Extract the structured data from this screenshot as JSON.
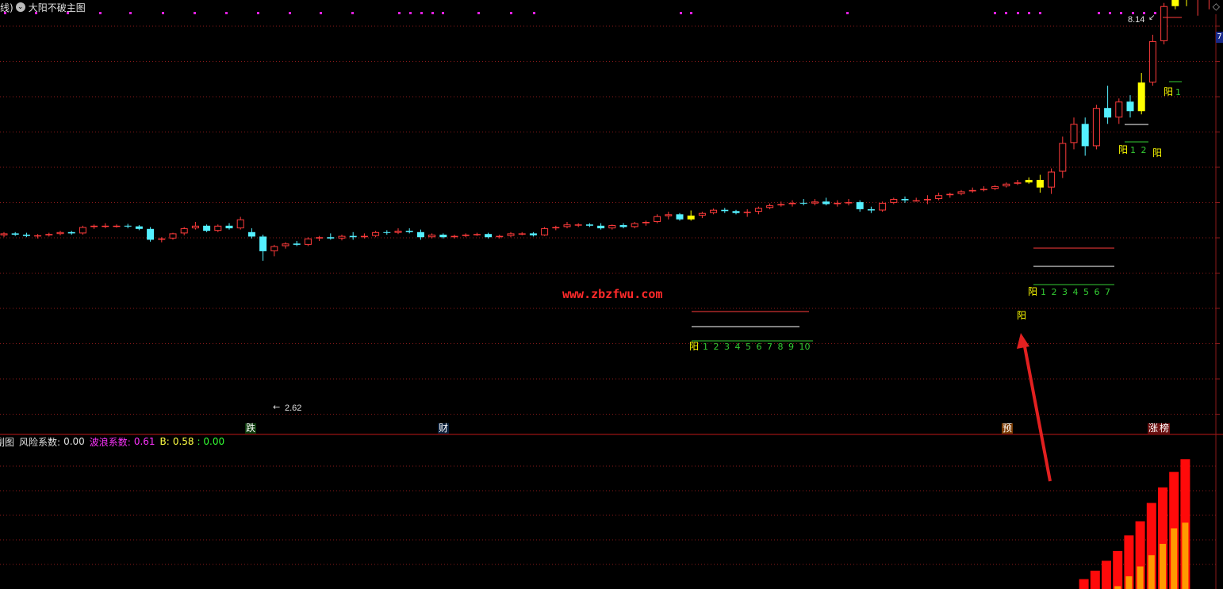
{
  "main": {
    "title_prefix": "线)",
    "title": "大阳不破主图",
    "price_tag": "7",
    "high_label": "8.14",
    "low_label": "2.62",
    "watermark": "www.zbzfwu.com",
    "signals": [
      {
        "text": "阳",
        "nums": "1 2 3 4 5 6 7 8 9 10"
      },
      {
        "text": "阳",
        "nums": "1 2 3 4 5 6 7"
      },
      {
        "text": "阳",
        "nums": "1 2"
      },
      {
        "text": "阳",
        "nums": "1"
      }
    ],
    "bottom_tags": [
      "跌",
      "财",
      "预",
      "涨",
      "榜"
    ]
  },
  "sub": {
    "name": "副图",
    "risk_label": "风险系数:",
    "risk_value": "0.00",
    "wave_label": "波浪系数:",
    "wave_value": "0.61",
    "b_label": "B:",
    "b_value": "0.58",
    "extra_value": ": 0.00"
  },
  "colors": {
    "up": "#ff3b3b",
    "down": "#54f0ff",
    "signal": "#ffff00",
    "count": "#33cc33",
    "grid": "#8b1a1a",
    "bar_red": "#ff0a0a",
    "bar_orange": "#ff9900"
  },
  "chart_data": {
    "type": "candlestick",
    "series": [
      {
        "name": "price",
        "candles": [
          [
            2.95,
            3.0,
            2.92,
            2.98
          ],
          [
            2.98,
            3.0,
            2.94,
            2.96
          ],
          [
            2.96,
            2.99,
            2.92,
            2.94
          ],
          [
            2.94,
            2.97,
            2.9,
            2.95
          ],
          [
            2.95,
            2.99,
            2.93,
            2.97
          ],
          [
            2.97,
            3.02,
            2.95,
            3.0
          ],
          [
            3.0,
            3.02,
            2.96,
            2.98
          ],
          [
            2.98,
            3.1,
            2.96,
            3.08
          ],
          [
            3.08,
            3.12,
            3.05,
            3.1
          ],
          [
            3.1,
            3.14,
            3.06,
            3.1
          ],
          [
            3.1,
            3.12,
            3.07,
            3.1
          ],
          [
            3.1,
            3.13,
            3.06,
            3.09
          ],
          [
            3.09,
            3.11,
            3.03,
            3.05
          ],
          [
            3.05,
            3.08,
            2.85,
            2.88
          ],
          [
            2.88,
            2.92,
            2.84,
            2.9
          ],
          [
            2.9,
            2.99,
            2.88,
            2.98
          ],
          [
            2.98,
            3.08,
            2.95,
            3.06
          ],
          [
            3.06,
            3.16,
            3.04,
            3.1
          ],
          [
            3.1,
            3.12,
            3.0,
            3.02
          ],
          [
            3.02,
            3.12,
            3.0,
            3.1
          ],
          [
            3.1,
            3.14,
            3.04,
            3.06
          ],
          [
            3.06,
            3.24,
            3.04,
            3.2
          ],
          [
            3.0,
            3.06,
            2.9,
            2.93
          ],
          [
            2.93,
            2.96,
            2.55,
            2.7
          ],
          [
            2.7,
            2.8,
            2.62,
            2.78
          ],
          [
            2.78,
            2.84,
            2.74,
            2.82
          ],
          [
            2.82,
            2.86,
            2.78,
            2.8
          ],
          [
            2.8,
            2.92,
            2.78,
            2.9
          ],
          [
            2.9,
            2.94,
            2.86,
            2.92
          ],
          [
            2.92,
            2.98,
            2.88,
            2.9
          ],
          [
            2.9,
            2.96,
            2.87,
            2.94
          ],
          [
            2.94,
            3.0,
            2.88,
            2.92
          ],
          [
            2.92,
            2.98,
            2.9,
            2.94
          ],
          [
            2.94,
            3.02,
            2.92,
            3.0
          ],
          [
            3.0,
            3.03,
            2.96,
            2.99
          ],
          [
            2.99,
            3.06,
            2.97,
            3.02
          ],
          [
            3.02,
            3.06,
            2.98,
            3.0
          ],
          [
            3.0,
            3.04,
            2.88,
            2.92
          ],
          [
            2.92,
            2.98,
            2.9,
            2.96
          ],
          [
            2.96,
            2.98,
            2.9,
            2.92
          ],
          [
            2.92,
            2.96,
            2.9,
            2.94
          ],
          [
            2.94,
            2.98,
            2.92,
            2.96
          ],
          [
            2.96,
            2.99,
            2.94,
            2.97
          ],
          [
            2.97,
            2.99,
            2.9,
            2.92
          ],
          [
            2.92,
            2.96,
            2.9,
            2.94
          ],
          [
            2.94,
            3.0,
            2.92,
            2.98
          ],
          [
            2.98,
            3.0,
            2.95,
            2.98
          ],
          [
            2.98,
            3.0,
            2.93,
            2.95
          ],
          [
            2.95,
            3.08,
            2.94,
            3.06
          ],
          [
            3.06,
            3.1,
            3.03,
            3.08
          ],
          [
            3.08,
            3.16,
            3.06,
            3.12
          ],
          [
            3.12,
            3.14,
            3.08,
            3.12
          ],
          [
            3.12,
            3.14,
            3.08,
            3.1
          ],
          [
            3.1,
            3.14,
            3.04,
            3.06
          ],
          [
            3.06,
            3.12,
            3.04,
            3.11
          ],
          [
            3.11,
            3.14,
            3.06,
            3.08
          ],
          [
            3.08,
            3.16,
            3.06,
            3.14
          ],
          [
            3.14,
            3.18,
            3.1,
            3.16
          ],
          [
            3.16,
            3.28,
            3.14,
            3.25
          ],
          [
            3.25,
            3.32,
            3.2,
            3.28
          ],
          [
            3.28,
            3.3,
            3.18,
            3.2
          ],
          [
            3.2,
            3.34,
            3.18,
            3.26
          ],
          [
            3.26,
            3.32,
            3.22,
            3.3
          ],
          [
            3.3,
            3.37,
            3.28,
            3.35
          ],
          [
            3.35,
            3.38,
            3.3,
            3.33
          ],
          [
            3.33,
            3.35,
            3.28,
            3.3
          ],
          [
            3.3,
            3.36,
            3.24,
            3.32
          ],
          [
            3.32,
            3.4,
            3.28,
            3.38
          ],
          [
            3.38,
            3.45,
            3.36,
            3.42
          ],
          [
            3.42,
            3.48,
            3.4,
            3.44
          ],
          [
            3.44,
            3.5,
            3.4,
            3.46
          ],
          [
            3.46,
            3.52,
            3.42,
            3.45
          ],
          [
            3.45,
            3.52,
            3.42,
            3.48
          ],
          [
            3.48,
            3.54,
            3.42,
            3.44
          ],
          [
            3.44,
            3.5,
            3.4,
            3.46
          ],
          [
            3.46,
            3.52,
            3.42,
            3.47
          ],
          [
            3.47,
            3.5,
            3.32,
            3.36
          ],
          [
            3.36,
            3.4,
            3.3,
            3.34
          ],
          [
            3.34,
            3.48,
            3.32,
            3.46
          ],
          [
            3.46,
            3.54,
            3.44,
            3.52
          ],
          [
            3.52,
            3.56,
            3.46,
            3.5
          ],
          [
            3.5,
            3.54,
            3.48,
            3.5
          ],
          [
            3.5,
            3.58,
            3.44,
            3.52
          ],
          [
            3.52,
            3.62,
            3.5,
            3.58
          ],
          [
            3.58,
            3.62,
            3.54,
            3.6
          ],
          [
            3.6,
            3.66,
            3.58,
            3.64
          ],
          [
            3.64,
            3.7,
            3.62,
            3.66
          ],
          [
            3.66,
            3.72,
            3.64,
            3.68
          ],
          [
            3.68,
            3.74,
            3.66,
            3.72
          ],
          [
            3.72,
            3.78,
            3.7,
            3.76
          ],
          [
            3.76,
            3.82,
            3.74,
            3.78
          ],
          [
            3.78,
            3.86,
            3.76,
            3.82
          ],
          [
            3.82,
            3.9,
            3.62,
            3.7
          ],
          [
            3.7,
            4.0,
            3.6,
            3.95
          ],
          [
            3.95,
            4.5,
            3.85,
            4.4
          ],
          [
            4.4,
            4.8,
            4.3,
            4.7
          ],
          [
            4.7,
            4.8,
            4.2,
            4.35
          ],
          [
            4.35,
            5.0,
            4.3,
            4.95
          ],
          [
            4.95,
            5.3,
            4.7,
            4.8
          ],
          [
            4.8,
            5.1,
            4.7,
            5.05
          ],
          [
            5.05,
            5.15,
            4.8,
            4.9
          ],
          [
            4.9,
            5.5,
            4.85,
            5.35
          ],
          [
            5.35,
            6.1,
            5.3,
            6.0
          ],
          [
            6.0,
            6.6,
            5.95,
            6.55
          ],
          [
            6.55,
            7.2,
            6.5,
            7.1
          ],
          [
            7.1,
            7.2,
            6.55,
            6.7
          ],
          [
            6.7,
            7.2,
            6.4,
            7.1
          ],
          [
            6.8,
            7.7,
            6.5,
            7.6
          ],
          [
            7.6,
            8.14,
            7.5,
            8.05
          ],
          [
            7.8,
            7.9,
            7.55,
            7.68
          ]
        ]
      }
    ],
    "sub_series": {
      "bars_red": [
        0,
        0,
        0,
        0,
        0,
        0,
        0,
        0,
        0.07,
        0.13,
        0.2,
        0.27,
        0.38,
        0.48,
        0.61,
        0.72,
        0.83,
        0.92
      ],
      "bars_orange": [
        0,
        0,
        0,
        0,
        0,
        0,
        0,
        0,
        0,
        0,
        0,
        0.02,
        0.09,
        0.16,
        0.24,
        0.32,
        0.43,
        0.47
      ]
    }
  }
}
